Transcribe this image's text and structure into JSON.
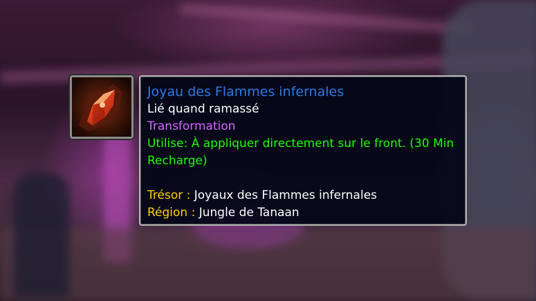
{
  "item": {
    "icon": "red-gem-icon",
    "name": "Joyau des Flammes infernales",
    "binding": "Lié quand ramassé",
    "category": "Transformation",
    "use_text": "Utilise: À appliquer directement sur le front. (30 Min Recharge)",
    "treasure_label": "Trésor :",
    "treasure_value": "Joyaux des Flammes infernales",
    "region_label": "Région :",
    "region_value": "Jungle de Tanaan"
  },
  "colors": {
    "title": "#2b7be4",
    "category": "#d466ff",
    "use": "#1eff00",
    "label": "#ffd100"
  }
}
